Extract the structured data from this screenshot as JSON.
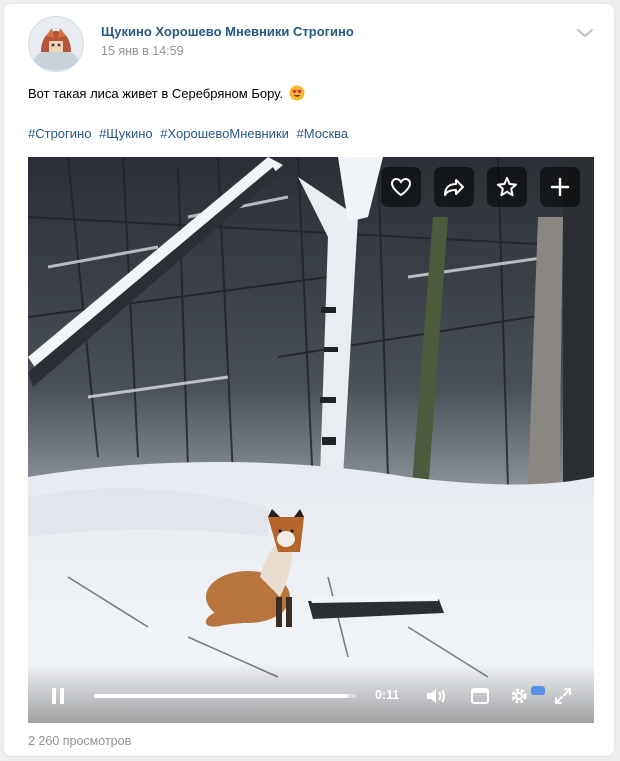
{
  "post": {
    "author": "Щукино Хорошево Мневники Строгино",
    "date": "15 янв в 14:59",
    "text": "Вот такая лиса живет в Серебряном Бору.",
    "emoji": "heart-eyes-emoji",
    "hashtags": [
      "#Строгино",
      "#Щукино",
      "#ХорошевоМневники",
      "#Москва"
    ],
    "views": "2 260 просмотров"
  },
  "video": {
    "time": "0:11",
    "progress": 0.97,
    "actions": [
      "heart-icon",
      "share-icon",
      "star-icon",
      "plus-icon"
    ],
    "controls": [
      "pause-icon",
      "volume-icon",
      "fullscreen-window-icon",
      "settings-icon",
      "expand-icon"
    ]
  },
  "colors": {
    "link": "#2a5885",
    "meta": "#939393",
    "background": "#edeef0",
    "badge": "#5b8ee6"
  }
}
